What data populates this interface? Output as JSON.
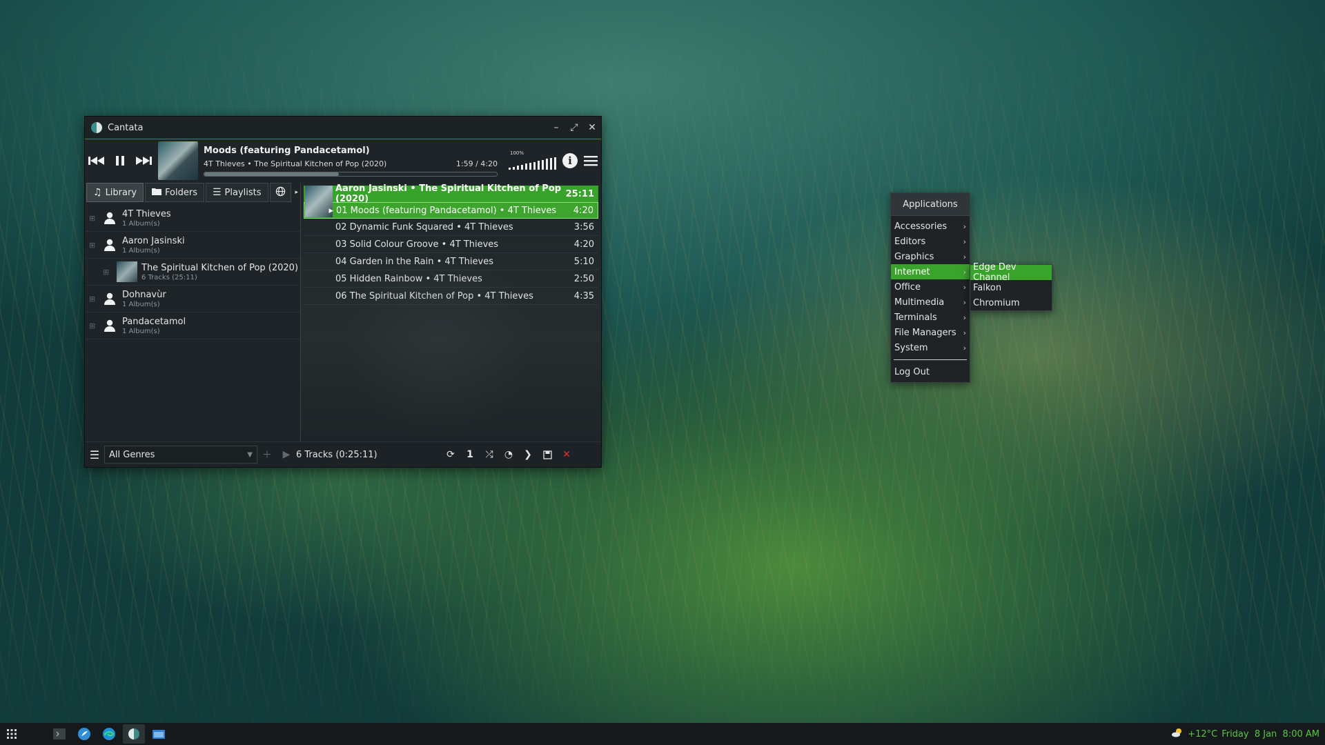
{
  "window": {
    "title": "Cantata"
  },
  "player": {
    "song_title": "Moods (featuring Pandacetamol)",
    "song_subtitle": "4T Thieves • The Spiritual Kitchen of Pop (2020)",
    "time": "1:59 / 4:20",
    "progress": 0.46,
    "volume_label": "100%",
    "volume_level": 1.0
  },
  "tabs": {
    "library": "Library",
    "folders": "Folders",
    "playlists": "Playlists"
  },
  "library": {
    "artists": [
      {
        "name": "4T Thieves",
        "sub": "1 Album(s)"
      },
      {
        "name": "Aaron Jasinski",
        "sub": "1 Album(s)"
      },
      {
        "name": "The Spiritual Kitchen of Pop (2020)",
        "sub": "6 Tracks (25:11)"
      },
      {
        "name": "Dohnavùr",
        "sub": "1 Album(s)"
      },
      {
        "name": "Pandacetamol",
        "sub": "1 Album(s)"
      }
    ]
  },
  "playqueue": {
    "header": {
      "label": "Aaron Jasinski • The Spiritual Kitchen of Pop (2020)",
      "duration": "25:11"
    },
    "rows": [
      {
        "label": "01 Moods (featuring Pandacetamol) • 4T Thieves",
        "duration": "4:20"
      },
      {
        "label": "02 Dynamic Funk Squared • 4T Thieves",
        "duration": "3:56"
      },
      {
        "label": "03 Solid Colour Groove • 4T Thieves",
        "duration": "4:20"
      },
      {
        "label": "04 Garden in the Rain • 4T Thieves",
        "duration": "5:10"
      },
      {
        "label": "05 Hidden Rainbow • 4T Thieves",
        "duration": "2:50"
      },
      {
        "label": "06 The Spiritual Kitchen of Pop • 4T Thieves",
        "duration": "4:35"
      }
    ]
  },
  "bottom": {
    "genre": "All Genres",
    "tracks": "6 Tracks (0:25:11)"
  },
  "appmenu": {
    "header": "Applications",
    "items": [
      "Accessories",
      "Editors",
      "Graphics",
      "Internet",
      "Office",
      "Multimedia",
      "Terminals",
      "File Managers",
      "System"
    ],
    "logout": "Log Out",
    "submenu": [
      "Edge Dev Channel",
      "Falkon",
      "Chromium"
    ]
  },
  "taskbar": {
    "weather": "+12°C",
    "clock": "Friday  8 Jan  8:00 AM"
  },
  "colors": {
    "accent": "#3aa32b",
    "clock": "#55c83e"
  }
}
